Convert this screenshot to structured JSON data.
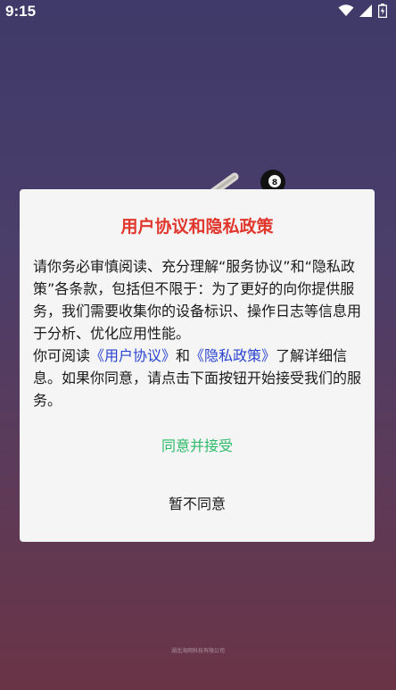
{
  "status_bar": {
    "time": "9:15",
    "icons": [
      "wifi-icon",
      "cell-signal-icon",
      "battery-icon"
    ]
  },
  "dialog": {
    "title": "用户协议和隐私政策",
    "paragraph1": "请你务必审慎阅读、充分理解“服务协议”和“隐私政策”各条款，包括但不限于：为了更好的向你提供服务，我们需要收集你的设备标识、操作日志等信息用于分析、优化应用性能。",
    "p2_prefix": "你可阅读",
    "user_agreement_link": "《用户协议》",
    "p2_and": "和",
    "privacy_policy_link": "《隐私政策》",
    "p2_suffix": "了解详细信息。如果你同意，请点击下面按钮开始接受我们的服务。",
    "agree_label": "同意并接受",
    "disagree_label": "暂不同意"
  },
  "footer": {
    "text": "湖北海网科技有限公司"
  },
  "colors": {
    "title": "#e0362c",
    "link": "#2a44d0",
    "agree": "#2dbb6a",
    "dialog_bg": "#f5f5f5",
    "bg_top": "#3f3a69",
    "bg_bottom": "#6a3446"
  }
}
